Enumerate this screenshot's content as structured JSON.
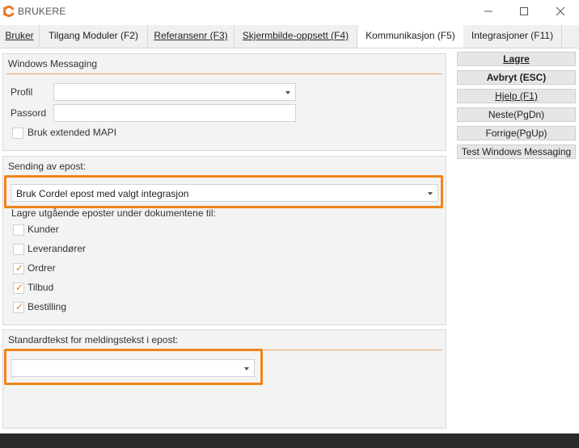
{
  "window": {
    "title": "BRUKERE",
    "minimize_icon": "minimize-icon",
    "maximize_icon": "maximize-icon",
    "close_icon": "close-icon"
  },
  "tabs": [
    {
      "label": "Bruker"
    },
    {
      "label": "Tilgang Moduler (F2)"
    },
    {
      "label": "Referansenr (F3)"
    },
    {
      "label": "Skjermbilde-oppsett (F4)"
    },
    {
      "label": "Kommunikasjon (F5)",
      "active": true
    },
    {
      "label": "Integrasjoner (F11)"
    }
  ],
  "messaging": {
    "title": "Windows Messaging",
    "profile_label": "Profil",
    "profile_value": "",
    "password_label": "Passord",
    "password_value": "",
    "extended_mapi_label": "Bruk extended MAPI",
    "extended_mapi_checked": false
  },
  "email_sending": {
    "title": "Sending av epost:",
    "method_value": "Bruk Cordel epost med valgt integrasjon",
    "save_under_label": "Lagre utgående eposter under dokumentene til:",
    "options": [
      {
        "label": "Kunder",
        "checked": false
      },
      {
        "label": "Leverandører",
        "checked": false
      },
      {
        "label": "Ordrer",
        "checked": true
      },
      {
        "label": "Tilbud",
        "checked": true
      },
      {
        "label": "Bestilling",
        "checked": true
      }
    ]
  },
  "standard_text": {
    "title": "Standardtekst for meldingstekst i epost:",
    "value": ""
  },
  "side_buttons": {
    "save": "Lagre",
    "cancel": "Avbryt (ESC)",
    "help": "Hjelp (F1)",
    "next": "Neste(PgDn)",
    "previous": "Forrige(PgUp)",
    "test": "Test Windows Messaging"
  },
  "colors": {
    "accent": "#f08418",
    "check": "#e07a1f"
  }
}
